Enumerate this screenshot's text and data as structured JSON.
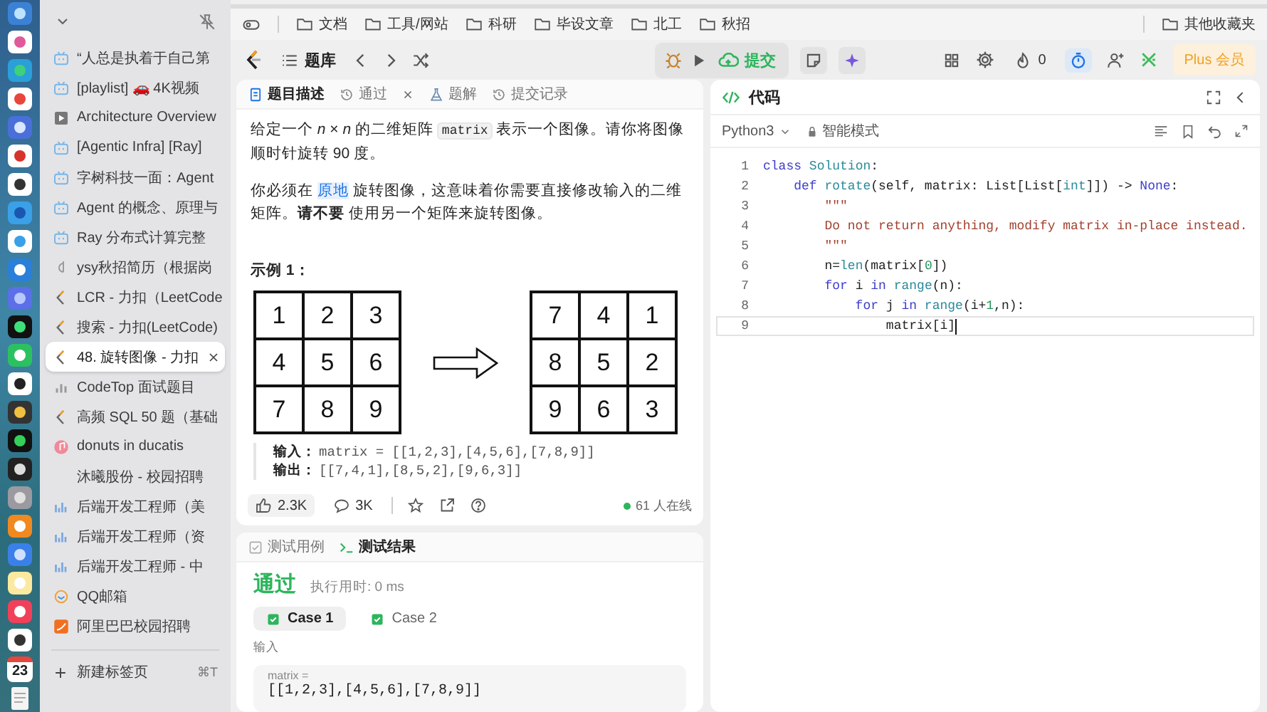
{
  "dock": {
    "calendar_day": "23"
  },
  "sidebar": {
    "tabs": [
      {
        "title": "“人总是执着于自己第",
        "kind": "tv",
        "selected": false
      },
      {
        "title": "[playlist] 🚗 4K视频",
        "kind": "tv",
        "selected": false
      },
      {
        "title": "Architecture Overview",
        "kind": "video",
        "selected": false
      },
      {
        "title": "[Agentic Infra] [Ray]",
        "kind": "tv",
        "selected": false
      },
      {
        "title": "字树科技一面：Agent",
        "kind": "tv",
        "selected": false
      },
      {
        "title": "Agent 的概念、原理与",
        "kind": "tv",
        "selected": false
      },
      {
        "title": "Ray 分布式计算完整",
        "kind": "tv",
        "selected": false
      },
      {
        "title": "ysy秋招简历（根据岗",
        "kind": "doc",
        "selected": false
      },
      {
        "title": "LCR - 力扣（LeetCode",
        "kind": "leetcode",
        "selected": false
      },
      {
        "title": "搜索 - 力扣(LeetCode)",
        "kind": "leetcode",
        "selected": false
      },
      {
        "title": "48. 旋转图像 - 力扣",
        "kind": "leetcode",
        "selected": true
      },
      {
        "title": "CodeTop 面试题目",
        "kind": "chart",
        "selected": false
      },
      {
        "title": "高频 SQL 50 题（基础",
        "kind": "leetcode",
        "selected": false
      },
      {
        "title": "donuts in ducatis",
        "kind": "music",
        "selected": false
      },
      {
        "title": "沐曦股份 - 校园招聘",
        "kind": "none",
        "selected": false
      },
      {
        "title": "后端开发工程师（美",
        "kind": "jobs",
        "selected": false
      },
      {
        "title": "后端开发工程师（资",
        "kind": "jobs",
        "selected": false
      },
      {
        "title": "后端开发工程师 - 中",
        "kind": "jobs",
        "selected": false
      },
      {
        "title": "QQ邮箱",
        "kind": "mail",
        "selected": false
      },
      {
        "title": "阿里巴巴校园招聘",
        "kind": "shop",
        "selected": false
      }
    ],
    "new_tab": {
      "label": "新建标签页",
      "shortcut": "⌘T"
    }
  },
  "bookmarks": {
    "folders": [
      {
        "label": "文档"
      },
      {
        "label": "工具/网站"
      },
      {
        "label": "科研"
      },
      {
        "label": "毕设文章"
      },
      {
        "label": "北工"
      },
      {
        "label": "秋招"
      }
    ],
    "other": "其他收藏夹"
  },
  "toolbar": {
    "problem_list": "题库",
    "submit": "提交",
    "streak": "0",
    "timer_on": true,
    "plus": "Plus 会员"
  },
  "description": {
    "tabs": [
      {
        "label": "题目描述",
        "selected": true,
        "closable": false
      },
      {
        "label": "通过",
        "selected": false,
        "closable": true
      },
      {
        "label": "题解",
        "selected": false,
        "closable": false
      },
      {
        "label": "提交记录",
        "selected": false,
        "closable": false
      }
    ],
    "paragraphs": [
      [
        {
          "kind": "text",
          "text": "给定一个 "
        },
        {
          "kind": "math",
          "text": "n"
        },
        {
          "kind": "text",
          "text": " × "
        },
        {
          "kind": "math",
          "text": "n"
        },
        {
          "kind": "text",
          "text": " 的二维矩阵 "
        },
        {
          "kind": "code",
          "text": "matrix"
        },
        {
          "kind": "text",
          "text": " 表示一个图像。请你将图像顺时针旋转 90 度。"
        }
      ],
      [
        {
          "kind": "text",
          "text": "你必须在 "
        },
        {
          "kind": "link",
          "text": "原地"
        },
        {
          "kind": "text",
          "text": " 旋转图像，这意味着你需要直接修改输入的二维矩阵。"
        },
        {
          "kind": "bold",
          "text": "请不要"
        },
        {
          "kind": "text",
          "text": " 使用另一个矩阵来旋转图像。"
        }
      ]
    ],
    "example": {
      "title": "示例 1：",
      "input_grid": [
        [
          "1",
          "2",
          "3"
        ],
        [
          "4",
          "5",
          "6"
        ],
        [
          "7",
          "8",
          "9"
        ]
      ],
      "output_grid": [
        [
          "7",
          "4",
          "1"
        ],
        [
          "8",
          "5",
          "2"
        ],
        [
          "9",
          "6",
          "3"
        ]
      ],
      "input_label": "输入：",
      "input_value": "matrix = [[1,2,3],[4,5,6],[7,8,9]]",
      "output_label": "输出：",
      "output_value": "[[7,4,1],[8,5,2],[9,6,3]]"
    },
    "stats": {
      "likes": "2.3K",
      "comments": "3K",
      "online": "61 人在线"
    }
  },
  "results": {
    "tabs": [
      {
        "label": "测试用例",
        "selected": false
      },
      {
        "label": "测试结果",
        "selected": true
      }
    ],
    "status": "通过",
    "runtime": "执行用时: 0 ms",
    "cases": [
      {
        "label": "Case 1",
        "selected": true,
        "passed": true
      },
      {
        "label": "Case 2",
        "selected": false,
        "passed": true
      }
    ],
    "input_heading": "输入",
    "input_name": "matrix =",
    "input_value": "[[1,2,3],[4,5,6],[7,8,9]]"
  },
  "code": {
    "title": "代码",
    "language": "Python3",
    "mode": "智能模式",
    "lines": [
      {
        "number": "1",
        "current": false,
        "tokens": [
          {
            "kind": "keyword",
            "text": "class"
          },
          {
            "kind": "type",
            "text": " Solution"
          },
          {
            "kind": "plain",
            "text": ":"
          }
        ]
      },
      {
        "number": "2",
        "current": false,
        "tokens": [
          {
            "kind": "keyword",
            "text": "    def"
          },
          {
            "kind": "type",
            "text": " rotate"
          },
          {
            "kind": "plain",
            "text": "(self, matrix: List[List["
          },
          {
            "kind": "type",
            "text": "int"
          },
          {
            "kind": "plain",
            "text": "]]) -> "
          },
          {
            "kind": "keyword",
            "text": "None"
          },
          {
            "kind": "plain",
            "text": ":"
          }
        ]
      },
      {
        "number": "3",
        "current": false,
        "tokens": [
          {
            "kind": "string",
            "text": "        \"\"\""
          }
        ]
      },
      {
        "number": "4",
        "current": false,
        "tokens": [
          {
            "kind": "string",
            "text": "        Do not return anything, modify matrix in-place instead."
          }
        ]
      },
      {
        "number": "5",
        "current": false,
        "tokens": [
          {
            "kind": "string",
            "text": "        \"\"\""
          }
        ]
      },
      {
        "number": "6",
        "current": false,
        "tokens": [
          {
            "kind": "plain",
            "text": "        n="
          },
          {
            "kind": "type",
            "text": "len"
          },
          {
            "kind": "plain",
            "text": "(matrix["
          },
          {
            "kind": "number",
            "text": "0"
          },
          {
            "kind": "plain",
            "text": "])"
          }
        ]
      },
      {
        "number": "7",
        "current": false,
        "tokens": [
          {
            "kind": "keyword",
            "text": "        for"
          },
          {
            "kind": "plain",
            "text": " i "
          },
          {
            "kind": "keyword",
            "text": "in"
          },
          {
            "kind": "type",
            "text": " range"
          },
          {
            "kind": "plain",
            "text": "(n):"
          }
        ]
      },
      {
        "number": "8",
        "current": false,
        "tokens": [
          {
            "kind": "keyword",
            "text": "            for"
          },
          {
            "kind": "plain",
            "text": " j "
          },
          {
            "kind": "keyword",
            "text": "in"
          },
          {
            "kind": "type",
            "text": " range"
          },
          {
            "kind": "plain",
            "text": "(i+"
          },
          {
            "kind": "number",
            "text": "1"
          },
          {
            "kind": "plain",
            "text": ",n):"
          }
        ]
      },
      {
        "number": "9",
        "current": true,
        "tokens": [
          {
            "kind": "plain",
            "text": "                matrix[i]"
          }
        ]
      }
    ]
  }
}
